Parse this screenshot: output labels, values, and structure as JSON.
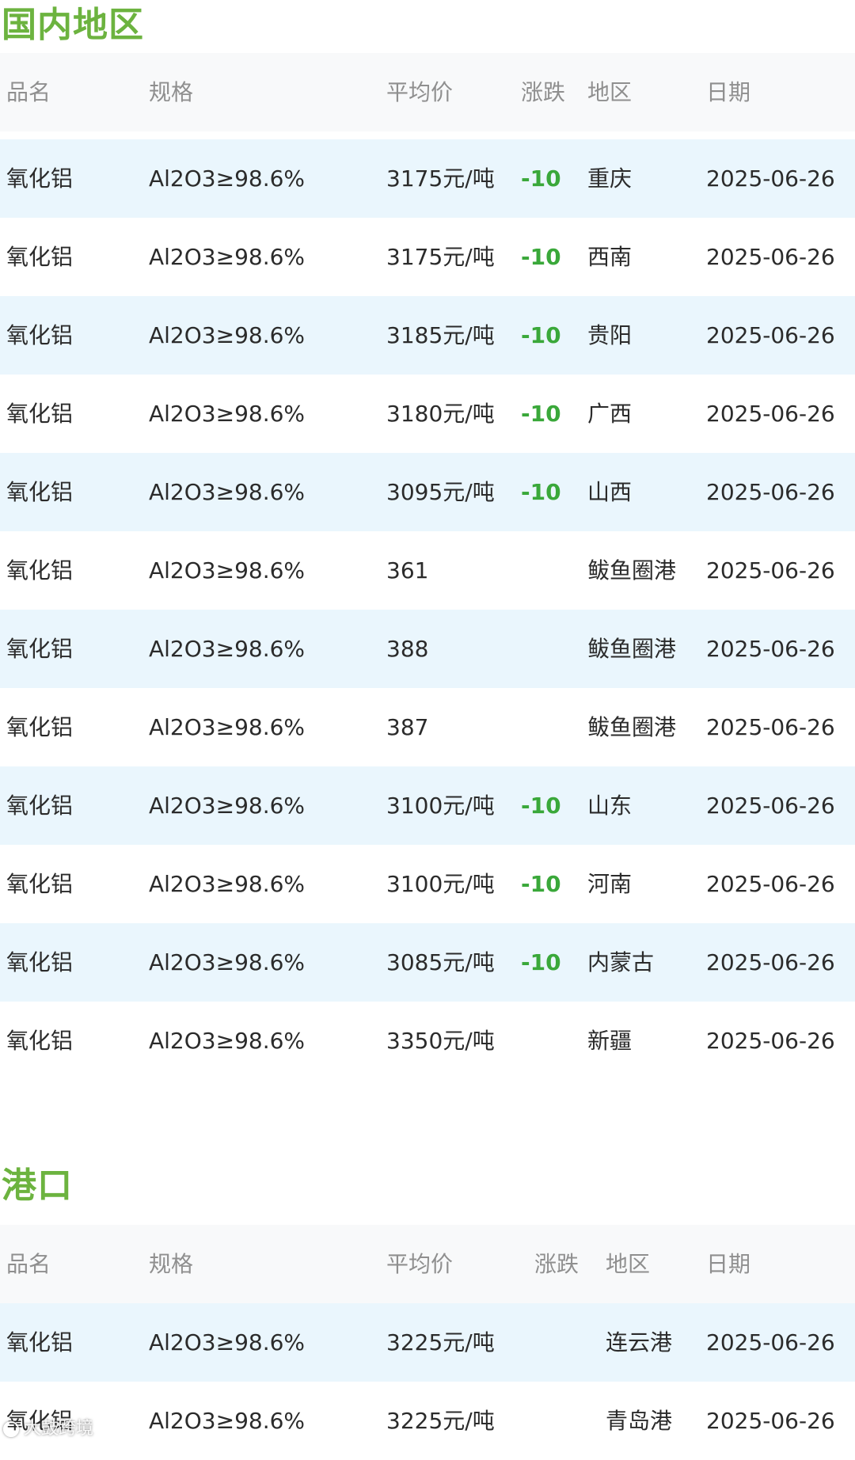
{
  "domestic": {
    "title": "国内地区",
    "headers": {
      "name": "品名",
      "spec": "规格",
      "price": "平均价",
      "change": "涨跌",
      "region": "地区",
      "date": "日期"
    },
    "rows": [
      {
        "name": "氧化铝",
        "spec": "Al2O3≥98.6%",
        "price": "3175元/吨",
        "change": "-10",
        "region": "重庆",
        "date": "2025-06-26"
      },
      {
        "name": "氧化铝",
        "spec": "Al2O3≥98.6%",
        "price": "3175元/吨",
        "change": "-10",
        "region": "西南",
        "date": "2025-06-26"
      },
      {
        "name": "氧化铝",
        "spec": "Al2O3≥98.6%",
        "price": "3185元/吨",
        "change": "-10",
        "region": "贵阳",
        "date": "2025-06-26"
      },
      {
        "name": "氧化铝",
        "spec": "Al2O3≥98.6%",
        "price": "3180元/吨",
        "change": "-10",
        "region": "广西",
        "date": "2025-06-26"
      },
      {
        "name": "氧化铝",
        "spec": "Al2O3≥98.6%",
        "price": "3095元/吨",
        "change": "-10",
        "region": "山西",
        "date": "2025-06-26"
      },
      {
        "name": "氧化铝",
        "spec": "Al2O3≥98.6%",
        "price": "361",
        "change": "",
        "region": "鲅鱼圈港",
        "date": "2025-06-26"
      },
      {
        "name": "氧化铝",
        "spec": "Al2O3≥98.6%",
        "price": "388",
        "change": "",
        "region": "鲅鱼圈港",
        "date": "2025-06-26"
      },
      {
        "name": "氧化铝",
        "spec": "Al2O3≥98.6%",
        "price": "387",
        "change": "",
        "region": "鲅鱼圈港",
        "date": "2025-06-26"
      },
      {
        "name": "氧化铝",
        "spec": "Al2O3≥98.6%",
        "price": "3100元/吨",
        "change": "-10",
        "region": "山东",
        "date": "2025-06-26"
      },
      {
        "name": "氧化铝",
        "spec": "Al2O3≥98.6%",
        "price": "3100元/吨",
        "change": "-10",
        "region": "河南",
        "date": "2025-06-26"
      },
      {
        "name": "氧化铝",
        "spec": "Al2O3≥98.6%",
        "price": "3085元/吨",
        "change": "-10",
        "region": "内蒙古",
        "date": "2025-06-26"
      },
      {
        "name": "氧化铝",
        "spec": "Al2O3≥98.6%",
        "price": "3350元/吨",
        "change": "",
        "region": "新疆",
        "date": "2025-06-26"
      }
    ]
  },
  "port": {
    "title": "港口",
    "headers": {
      "name": "品名",
      "spec": "规格",
      "price": "平均价",
      "change": "涨跌",
      "region": "地区",
      "date": "日期"
    },
    "rows": [
      {
        "name": "氧化铝",
        "spec": "Al2O3≥98.6%",
        "price": "3225元/吨",
        "change": "",
        "region": "连云港",
        "date": "2025-06-26"
      },
      {
        "name": "氧化铝",
        "spec": "Al2O3≥98.6%",
        "price": "3225元/吨",
        "change": "",
        "region": "青岛港",
        "date": "2025-06-26"
      }
    ]
  },
  "watermark": {
    "text": "大鼓跨境"
  },
  "colors": {
    "accent": "#6cb33f",
    "change_down": "#3aa83a",
    "row_alt": "#eaf6fd",
    "header_bg": "#f8f9fa"
  }
}
